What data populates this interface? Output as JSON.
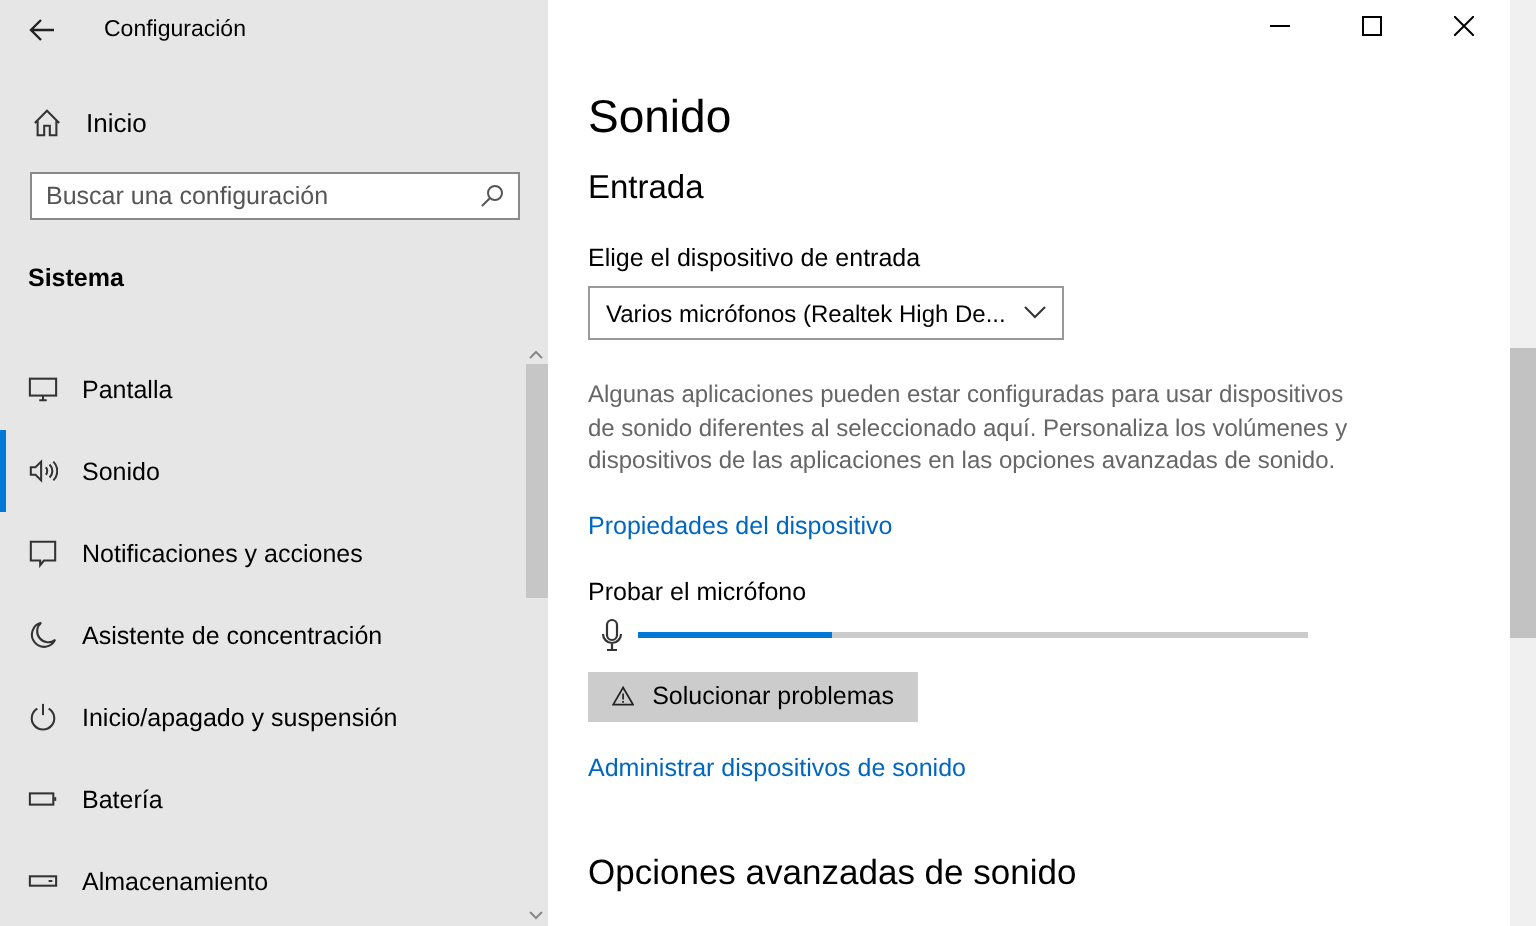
{
  "window": {
    "title": "Configuración"
  },
  "home": {
    "label": "Inicio"
  },
  "search": {
    "placeholder": "Buscar una configuración"
  },
  "sidebar": {
    "section": "Sistema",
    "items": [
      {
        "label": "Pantalla",
        "selected": false
      },
      {
        "label": "Sonido",
        "selected": true
      },
      {
        "label": "Notificaciones y acciones",
        "selected": false
      },
      {
        "label": "Asistente de concentración",
        "selected": false
      },
      {
        "label": "Inicio/apagado y suspensión",
        "selected": false
      },
      {
        "label": "Batería",
        "selected": false
      },
      {
        "label": "Almacenamiento",
        "selected": false
      }
    ]
  },
  "page": {
    "title": "Sonido",
    "section": "Entrada",
    "device_label": "Elige el dispositivo de entrada",
    "device_value": "Varios micrófonos (Realtek High De...",
    "description": "Algunas aplicaciones pueden estar configuradas para usar dispositivos de sonido diferentes al seleccionado aquí. Personaliza los volúmenes y dispositivos de las aplicaciones en las opciones avanzadas de sonido.",
    "properties_link": "Propiedades del dispositivo",
    "test_label": "Probar el micrófono",
    "mic_meter": {
      "level": 0.29
    },
    "troubleshoot_button": "Solucionar problemas",
    "manage_link": "Administrar dispositivos de sonido",
    "advanced_title": "Opciones avanzadas de sonido"
  }
}
